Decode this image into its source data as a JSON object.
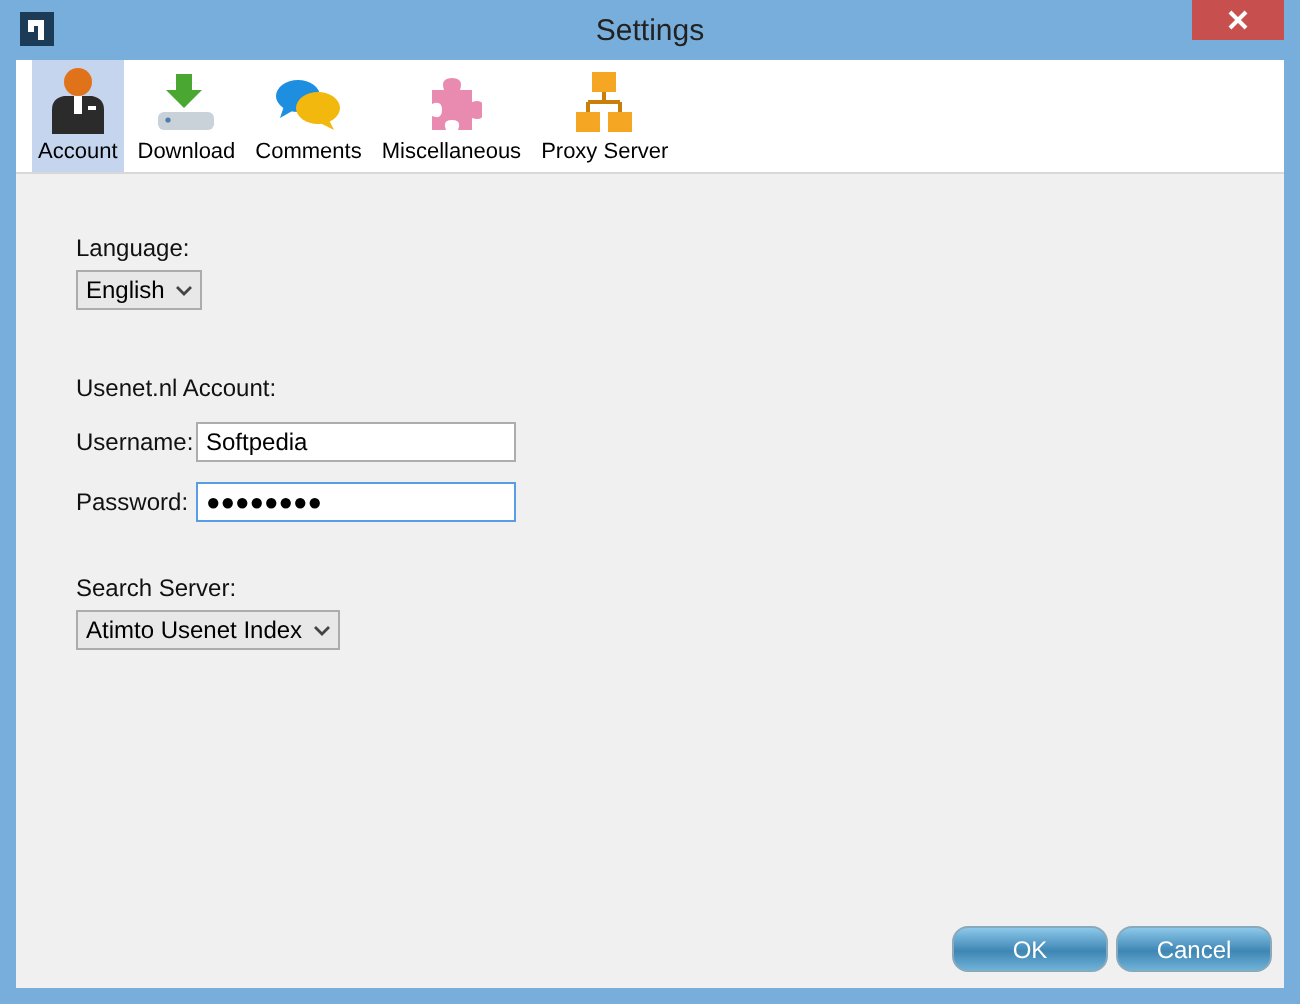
{
  "window": {
    "title": "Settings"
  },
  "toolbar": [
    {
      "label": "Account",
      "kind": "account",
      "selected": true
    },
    {
      "label": "Download",
      "kind": "download",
      "selected": false
    },
    {
      "label": "Comments",
      "kind": "comments",
      "selected": false
    },
    {
      "label": "Miscellaneous",
      "kind": "puzzle",
      "selected": false
    },
    {
      "label": "Proxy Server",
      "kind": "network",
      "selected": false
    }
  ],
  "form": [
    {
      "kind": "select",
      "label": "Language:",
      "value": "English"
    },
    {
      "kind": "heading",
      "label": "Usenet.nl Account:"
    },
    {
      "kind": "field",
      "label": "Username:",
      "value": "Softpedia",
      "focused": false
    },
    {
      "kind": "field",
      "label": "Password:",
      "value": "●●●●●●●●",
      "focused": true
    },
    {
      "kind": "select",
      "label": "Search Server:",
      "value": "Atimto Usenet Index"
    }
  ],
  "buttons": [
    "OK",
    "Cancel"
  ]
}
